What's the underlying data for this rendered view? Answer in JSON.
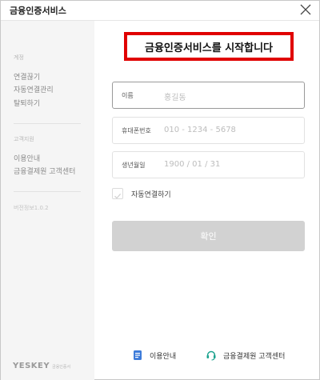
{
  "window": {
    "title": "금융인증서비스"
  },
  "sidebar": {
    "sections": [
      {
        "label": "계정",
        "items": [
          "연결끊기",
          "자동연결관리",
          "탈퇴하기"
        ]
      },
      {
        "label": "고객지원",
        "items": [
          "이용안내",
          "금융결제원 고객센터"
        ]
      }
    ],
    "version": "버전정보1.0.2",
    "brand": "YESKEY",
    "brand_sub": "금융인증서"
  },
  "main": {
    "headline": "금융인증서비스를 시작합니다",
    "fields": [
      {
        "label": "이름",
        "placeholder": "홍길동"
      },
      {
        "label": "휴대폰번호",
        "placeholder": "010 - 1234 - 5678"
      },
      {
        "label": "생년월일",
        "placeholder": "1900 / 01 / 31"
      }
    ],
    "auto_connect_label": "자동연결하기",
    "confirm_label": "확인"
  },
  "footer": {
    "guide_label": "이용안내",
    "support_label": "금융결제원 고객센터"
  },
  "colors": {
    "highlight": "#e00000",
    "button_disabled": "#d2d2d2",
    "guide_icon": "#3d7bd9",
    "support_icon": "#1aa38f"
  },
  "icons": {
    "close": "close-icon",
    "check": "check-icon",
    "guide": "document-icon",
    "support": "headset-icon"
  }
}
